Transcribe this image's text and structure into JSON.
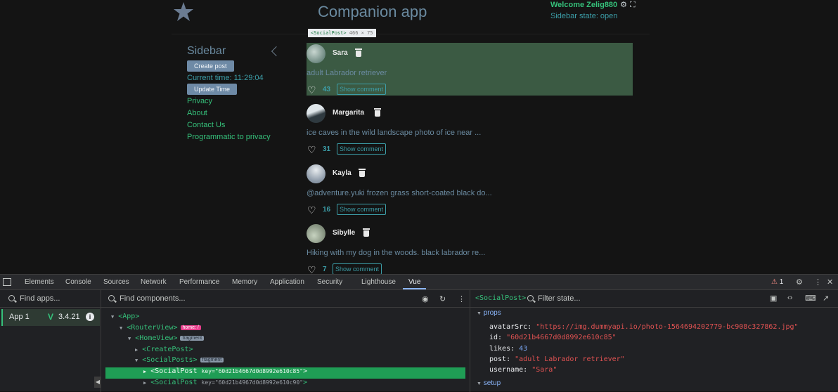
{
  "app": {
    "title": "Companion app",
    "welcome": "Welcome Zelig880",
    "sidebar_state": "Sidebar state: open"
  },
  "sidebar": {
    "title": "Sidebar",
    "create_post": "Create post",
    "current_time": "Current time: 11:29:04",
    "update_time": "Update Time",
    "links": [
      "Privacy",
      "About",
      "Contact Us",
      "Programmatic to privacy"
    ]
  },
  "tooltip": {
    "tag": "<SocialPost>",
    "size": "466 × 75"
  },
  "posts": [
    {
      "username": "Sara",
      "text": "adult Labrador retriever",
      "likes": "43",
      "show_comment": "Show comment"
    },
    {
      "username": "Margarita",
      "text": "ice caves in the wild landscape photo of ice near ...",
      "likes": "31",
      "show_comment": "Show comment"
    },
    {
      "username": "Kayla",
      "text": "@adventure.yuki frozen grass short-coated black do...",
      "likes": "16",
      "show_comment": "Show comment"
    },
    {
      "username": "Sibylle",
      "text": "Hiking with my dog in the woods. black labrador re...",
      "likes": "7",
      "show_comment": "Show comment"
    }
  ],
  "devtools": {
    "tabs": [
      "Elements",
      "Console",
      "Sources",
      "Network",
      "Performance",
      "Memory",
      "Application",
      "Security",
      "Lighthouse",
      "Vue"
    ],
    "active_tab": "Vue",
    "warnings": "1",
    "find_apps": "Find apps...",
    "find_components": "Find components...",
    "filter_state": "Filter state...",
    "state_component": "<SocialPost>",
    "app_name": "App 1",
    "vue_version": "3.4.21",
    "tree": [
      {
        "label": "<App>",
        "badge": ""
      },
      {
        "label": "<RouterView>",
        "badge": "home: /"
      },
      {
        "label": "<HomeView>",
        "badge": "fragment"
      },
      {
        "label": "<CreatePost>",
        "badge": ""
      },
      {
        "label": "<SocialPosts>",
        "badge": "fragment"
      },
      {
        "label": "<SocialPost",
        "key": "key=\"60d21b4667d0d8992e610c85\"",
        "close": ">"
      },
      {
        "label": "<SocialPost",
        "key": "key=\"60d21b4967d0d8992e610c90\"",
        "close": ">"
      }
    ],
    "props_label": "props",
    "setup_label": "setup",
    "props": [
      {
        "key": "avatarSrc:",
        "value": "\"https://img.dummyapi.io/photo-1564694202779-bc908c327862.jpg\""
      },
      {
        "key": "id:",
        "value": "\"60d21b4667d0d8992e610c85\""
      },
      {
        "key": "likes:",
        "value": "43"
      },
      {
        "key": "post:",
        "value": "\"adult Labrador retriever\""
      },
      {
        "key": "username:",
        "value": "\"Sara\""
      }
    ]
  }
}
